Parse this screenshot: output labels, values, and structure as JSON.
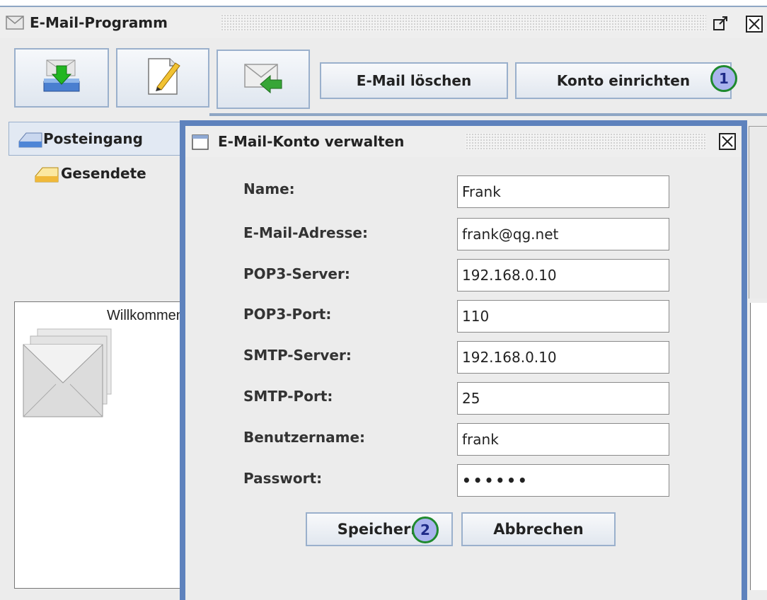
{
  "main_window": {
    "title": "E-Mail-Programm",
    "icon": "mail-window-icon",
    "controls": {
      "maximize": "maximize-icon",
      "close": "close-icon"
    }
  },
  "toolbar": {
    "receive_icon": "receive-mail-icon",
    "compose_icon": "compose-mail-icon",
    "reply_icon": "reply-mail-icon",
    "delete_label": "E-Mail löschen",
    "account_label": "Konto einrichten"
  },
  "tabs": [
    {
      "label": "Posteingang",
      "icon": "inbox-icon"
    },
    {
      "label": "Gesendete",
      "icon": "sent-icon"
    }
  ],
  "welcome": {
    "text": "Willkommen"
  },
  "dialog": {
    "title": "E-Mail-Konto verwalten",
    "fields": [
      {
        "label": "Name:",
        "value": "Frank"
      },
      {
        "label": "E-Mail-Adresse:",
        "value": "frank@qg.net"
      },
      {
        "label": "POP3-Server:",
        "value": "192.168.0.10"
      },
      {
        "label": "POP3-Port:",
        "value": "110"
      },
      {
        "label": "SMTP-Server:",
        "value": "192.168.0.10"
      },
      {
        "label": "SMTP-Port:",
        "value": "25"
      },
      {
        "label": "Benutzername:",
        "value": "frank"
      },
      {
        "label": "Passwort:",
        "value": "••••••"
      }
    ],
    "save_label": "Speichern",
    "cancel_label": "Abbrechen"
  },
  "badges": {
    "first": "1",
    "second": "2"
  },
  "colors": {
    "accent_border": "#5e82bd",
    "badge_ring": "#1f8a2e",
    "badge_fill": "#aab3ee"
  }
}
